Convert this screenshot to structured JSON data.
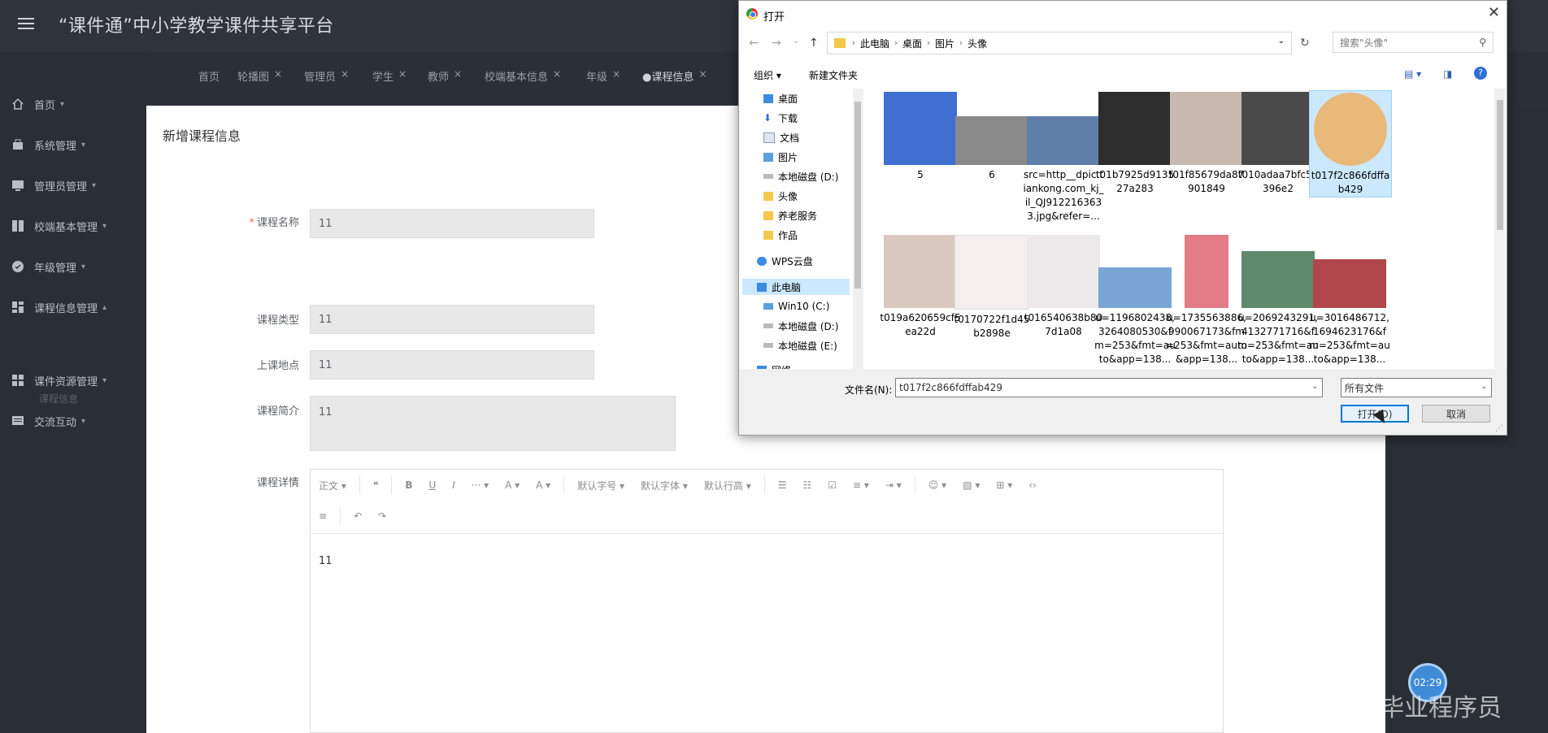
{
  "header": {
    "title": "“课件通”中小学教学课件共享平台"
  },
  "sidebar": {
    "items": [
      {
        "label": "首页",
        "icon": "home-icon"
      },
      {
        "label": "系统管理",
        "icon": "bag-icon"
      },
      {
        "label": "管理员管理",
        "icon": "monitor-icon"
      },
      {
        "label": "校端基本管理",
        "icon": "grid-icon"
      },
      {
        "label": "年级管理",
        "icon": "check-circle-icon"
      },
      {
        "label": "课程信息管理",
        "icon": "dashboard-icon"
      },
      {
        "label": "课件资源管理",
        "icon": "tiles-icon"
      },
      {
        "label": "交流互动",
        "icon": "chat-icon"
      }
    ],
    "sub_item": "课程信息"
  },
  "tabs": [
    "首页",
    "轮播图",
    "管理员",
    "学生",
    "教师",
    "校端基本信息",
    "年级",
    "课程信息"
  ],
  "form": {
    "title": "新增课程信息",
    "fields": [
      {
        "label": "课程名称",
        "value": "11",
        "required": true
      },
      {
        "label": "课程类型",
        "value": "11"
      },
      {
        "label": "上课地点",
        "value": "11"
      },
      {
        "label": "课程简介",
        "value": "11"
      }
    ],
    "details_label": "课程详情",
    "editor": {
      "toolbar1": [
        "正文 ▾",
        "❝",
        "B",
        "U",
        "I",
        "··· ▾",
        "A ▾",
        "A ▾",
        "默认字号 ▾",
        "默认字体 ▾",
        "默认行高 ▾",
        "☰",
        "☷",
        "☑",
        "≡ ▾",
        "⇥ ▾",
        "☺ ▾",
        "▨ ▾",
        "⊞ ▾",
        "‹›"
      ],
      "toolbar2": [
        "≡",
        "↶",
        "↷"
      ],
      "content": "11"
    }
  },
  "dialog": {
    "title": "打开",
    "breadcrumb": [
      "此电脑",
      "桌面",
      "图片",
      "头像"
    ],
    "search_placeholder": "搜索\"头像\"",
    "commands": {
      "organize": "组织 ▾",
      "new_folder": "新建文件夹"
    },
    "tree": [
      {
        "label": "桌面",
        "type": "desktop"
      },
      {
        "label": "下载",
        "type": "download"
      },
      {
        "label": "文档",
        "type": "doc"
      },
      {
        "label": "图片",
        "type": "pic"
      },
      {
        "label": "本地磁盘 (D:)",
        "type": "drive"
      },
      {
        "label": "头像",
        "type": "folder"
      },
      {
        "label": "养老服务",
        "type": "folder"
      },
      {
        "label": "作品",
        "type": "folder"
      },
      {
        "label": "WPS云盘",
        "type": "cloud"
      },
      {
        "label": "此电脑",
        "type": "pc"
      },
      {
        "label": "Win10 (C:)",
        "type": "drive"
      },
      {
        "label": "本地磁盘 (D:)",
        "type": "drive"
      },
      {
        "label": "本地磁盘 (E:)",
        "type": "drive"
      },
      {
        "label": "网络",
        "type": "network"
      }
    ],
    "files": [
      {
        "name": "5",
        "color": "#3f6fd0"
      },
      {
        "name": "6",
        "color": "#8a8a8a"
      },
      {
        "name": "src=http__dpic.tiankong.com_kj_il_QJ9122163633.jpg&refer=...",
        "color": "#5f7fa8"
      },
      {
        "name": "t01b7925d913527a283",
        "color": "#2d2d2d"
      },
      {
        "name": "t01f85679da87901849",
        "color": "#c7b8b0"
      },
      {
        "name": "t010adaa7bfc5e396e2",
        "color": "#4a4a4a"
      },
      {
        "name": "t017f2c866fdffab429",
        "color": "#e9b97a"
      },
      {
        "name": "t019a620659cf5ea22d",
        "color": "#d8c8c0"
      },
      {
        "name": "t0170722f1d45b2898e",
        "color": "#f4eeee"
      },
      {
        "name": "t016540638b807d1a08",
        "color": "#ece9ea"
      },
      {
        "name": "u=1196802438,3264080530&fm=253&fmt=auto&app=138...",
        "color": "#7aa6d6"
      },
      {
        "name": "u=1735563886,990067173&fm=253&fmt=auto&app=138...",
        "color": "#e47c88"
      },
      {
        "name": "u=2069243291,4132771716&fm=253&fmt=auto&app=138...",
        "color": "#5c8a6a"
      },
      {
        "name": "u=3016486712,1694623176&fm=253&fmt=auto&app=138...",
        "color": "#b0464a"
      }
    ],
    "filename_label": "文件名(N):",
    "filename_value": "t017f2c866fdffab429",
    "filetype": "所有文件",
    "open_button": "打开(O)",
    "cancel_button": "取消"
  },
  "overlay": {
    "timer": "02:29",
    "watermark": "CSDN @毕业程序员"
  }
}
